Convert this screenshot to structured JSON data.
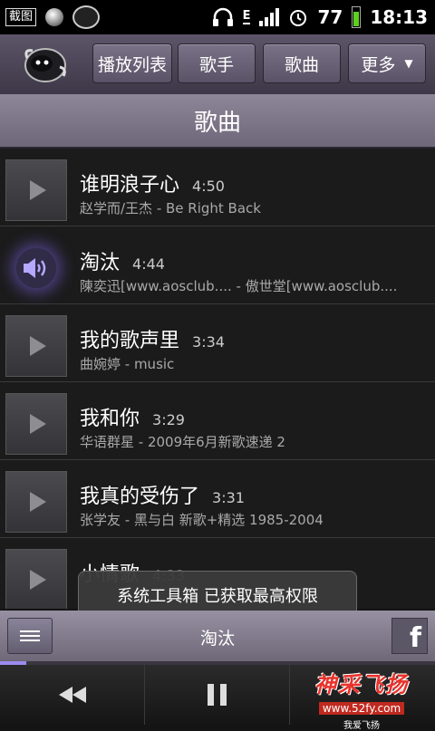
{
  "status_bar": {
    "screenshot_label": "截图",
    "battery": "77",
    "network": "E",
    "time": "18:13"
  },
  "nav": {
    "playlists": "播放列表",
    "artists": "歌手",
    "songs": "歌曲",
    "more": "更多",
    "more_arrow": "▼"
  },
  "title": "歌曲",
  "songs": [
    {
      "title": "谁明浪子心",
      "duration": "4:50",
      "subtitle": "赵学而/王杰  -  Be Right Back",
      "playing": false
    },
    {
      "title": "淘汰",
      "duration": "4:44",
      "subtitle": "陳奕迅[www.aosclub....  -  傲世堂[www.aosclub....",
      "playing": true
    },
    {
      "title": "我的歌声里",
      "duration": "3:34",
      "subtitle": "曲婉婷  -  music",
      "playing": false
    },
    {
      "title": "我和你",
      "duration": "3:29",
      "subtitle": "华语群星  -  2009年6月新歌速递 2",
      "playing": false
    },
    {
      "title": "我真的受伤了",
      "duration": "3:31",
      "subtitle": "张学友  -  黑与白 新歌+精选 1985-2004",
      "playing": false
    },
    {
      "title": "小情歌",
      "duration": "4:33",
      "subtitle": "",
      "playing": false
    }
  ],
  "toast": "系统工具箱 已获取最高权限",
  "now_playing": {
    "title": "淘汰",
    "progress_fraction": 0.06
  },
  "watermark": {
    "main": "神采飞扬",
    "url": "www.52fy.com",
    "tagline": "我爱飞扬"
  },
  "colors": {
    "accent": "#9c8cf0",
    "watermark_red": "#e8322b"
  }
}
